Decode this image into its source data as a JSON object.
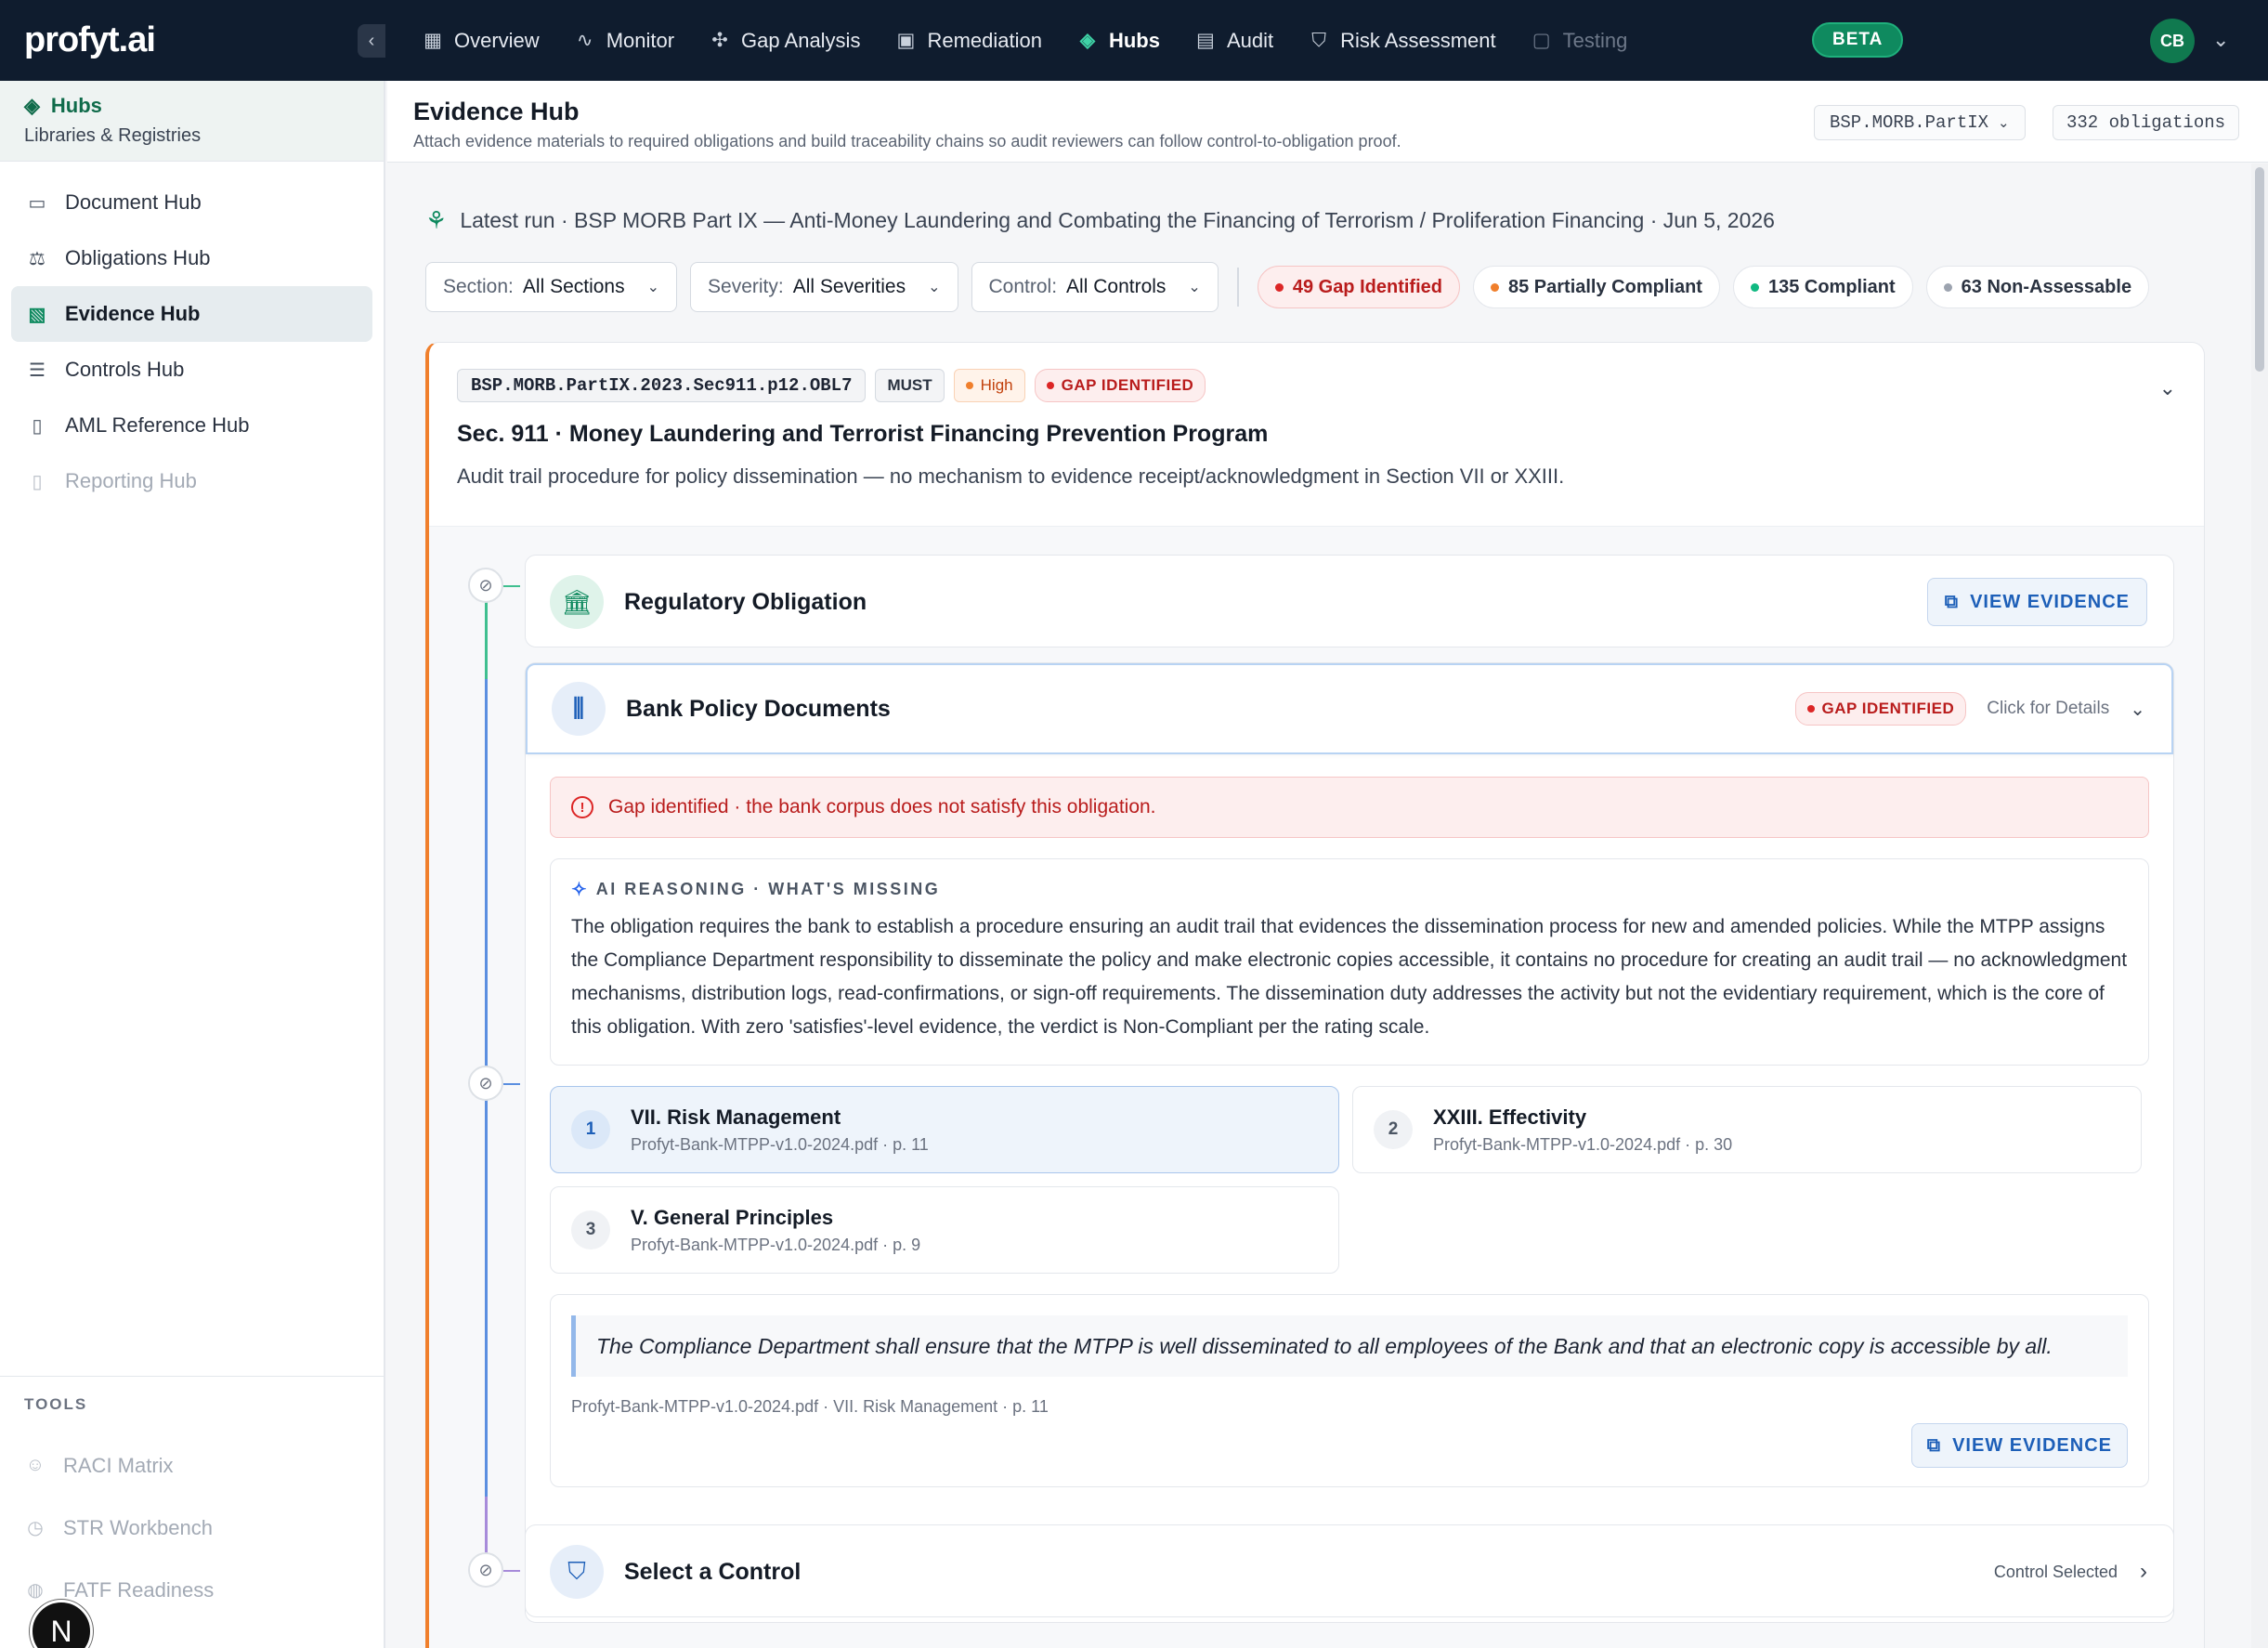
{
  "app": {
    "logo": "profyt.ai",
    "beta": "BETA",
    "user_initials": "CB"
  },
  "nav": [
    {
      "label": "Overview",
      "icon": "grid-icon"
    },
    {
      "label": "Monitor",
      "icon": "pulse-icon"
    },
    {
      "label": "Gap Analysis",
      "icon": "sparkle-move-icon"
    },
    {
      "label": "Remediation",
      "icon": "clipboard-icon"
    },
    {
      "label": "Hubs",
      "icon": "layers-icon",
      "active": true
    },
    {
      "label": "Audit",
      "icon": "file-chart-icon"
    },
    {
      "label": "Risk Assessment",
      "icon": "shield-icon"
    },
    {
      "label": "Testing",
      "icon": "clipboard-check-icon",
      "disabled": true
    }
  ],
  "sidebar": {
    "title": "Hubs",
    "subtitle": "Libraries & Registries",
    "items": [
      {
        "label": "Document Hub",
        "icon": "archive-icon"
      },
      {
        "label": "Obligations Hub",
        "icon": "scale-icon"
      },
      {
        "label": "Evidence Hub",
        "icon": "file-check-icon",
        "active": true
      },
      {
        "label": "Controls Hub",
        "icon": "list-check-icon"
      },
      {
        "label": "AML Reference Hub",
        "icon": "book-icon"
      },
      {
        "label": "Reporting Hub",
        "icon": "file-icon",
        "disabled": true
      }
    ],
    "tools_heading": "TOOLS",
    "tools": [
      {
        "label": "RACI Matrix",
        "icon": "users-icon"
      },
      {
        "label": "STR Workbench",
        "icon": "clock-icon"
      },
      {
        "label": "FATF Readiness",
        "icon": "globe-icon"
      }
    ]
  },
  "header": {
    "title": "Evidence Hub",
    "description": "Attach evidence materials to required obligations and build traceability chains so audit reviewers can follow control-to-obligation proof.",
    "regulation_select": "BSP.MORB.PartIX",
    "obligation_count": "332 obligations"
  },
  "run": {
    "text": "Latest run · BSP MORB Part IX — Anti-Money Laundering and Combating the Financing of Terrorism / Proliferation Financing · Jun 5, 2026"
  },
  "filters": {
    "section": {
      "label": "Section:",
      "value": "All Sections"
    },
    "severity": {
      "label": "Severity:",
      "value": "All Severities"
    },
    "control": {
      "label": "Control:",
      "value": "All Controls"
    }
  },
  "status_pills": [
    {
      "label": "49 Gap Identified",
      "color": "#dc2626"
    },
    {
      "label": "85 Partially Compliant",
      "color": "#f07f2c"
    },
    {
      "label": "135 Compliant",
      "color": "#10b981"
    },
    {
      "label": "63 Non-Assessable",
      "color": "#9ca3af"
    }
  ],
  "obligation": {
    "code": "BSP.MORB.PartIX.2023.Sec911.p12.OBL7",
    "modality": "MUST",
    "severity": "High",
    "status": "GAP IDENTIFIED",
    "title": "Sec. 911 · Money Laundering and Terrorist Financing Prevention Program",
    "description": "Audit trail procedure for policy dissemination — no mechanism to evidence receipt/acknowledgment in Section VII or XXIII."
  },
  "chain": {
    "regulatory": {
      "title": "Regulatory Obligation",
      "button": "VIEW EVIDENCE"
    },
    "bank_policy": {
      "title": "Bank Policy Documents",
      "status": "GAP IDENTIFIED",
      "details_label": "Click for Details",
      "alert": "Gap identified · the bank corpus does not satisfy this obligation.",
      "reasoning_heading": "AI REASONING · WHAT'S MISSING",
      "reasoning": "The obligation requires the bank to establish a procedure ensuring an audit trail that evidences the dissemination process for new and amended policies. While the MTPP assigns the Compliance Department responsibility to disseminate the policy and make electronic copies accessible, it contains no procedure for creating an audit trail — no acknowledgment mechanisms, distribution logs, read-confirmations, or sign-off requirements. The dissemination duty addresses the activity but not the evidentiary requirement, which is the core of this obligation. With zero 'satisfies'-level evidence, the verdict is Non-Compliant per the rating scale.",
      "references": [
        {
          "num": "1",
          "title": "VII. Risk Management",
          "source": "Profyt-Bank-MTPP-v1.0-2024.pdf · p. 11",
          "selected": true
        },
        {
          "num": "2",
          "title": "XXIII. Effectivity",
          "source": "Profyt-Bank-MTPP-v1.0-2024.pdf · p. 30"
        },
        {
          "num": "3",
          "title": "V. General Principles",
          "source": "Profyt-Bank-MTPP-v1.0-2024.pdf · p. 9"
        }
      ],
      "quote": "The Compliance Department shall ensure that the MTPP is well disseminated to all employees of the Bank and that an electronic copy is accessible by all.",
      "quote_source": "Profyt-Bank-MTPP-v1.0-2024.pdf · VII. Risk Management · p. 11",
      "quote_button": "VIEW EVIDENCE"
    },
    "control": {
      "title": "Select a Control",
      "status": "Control Selected"
    }
  },
  "colors": {
    "accent_green": "#0f8a5f",
    "gap_red": "#dc2626",
    "high_orange": "#f07f2c",
    "link_blue": "#1d5fb8"
  }
}
